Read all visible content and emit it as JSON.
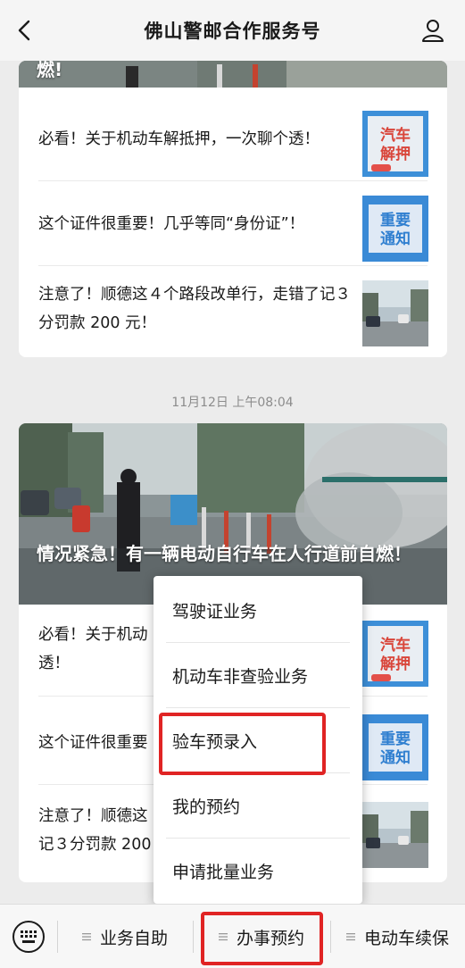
{
  "header": {
    "title": "佛山警邮合作服务号"
  },
  "card_top": {
    "hero_tail": "燃!",
    "rows": [
      {
        "text": "必看！关于机动车解抵押，一次聊个透！",
        "thumb_lines": [
          "汽车",
          "解押"
        ]
      },
      {
        "text": "这个证件很重要！几乎等同“身份证”！",
        "thumb_lines": [
          "重要",
          "通知"
        ]
      },
      {
        "text": "注意了！顺德这４个路段改单行，走错了记３分罚款 200 元！",
        "thumb_lines": []
      }
    ]
  },
  "timestamp": "11月12日 上午08:04",
  "card_main": {
    "hero_title": "情况紧急！有一辆电动自行车在人行道前自燃！",
    "rows": [
      {
        "text": "必看！关于机动车解抵押，一次聊个透！",
        "visible": "必看！关于机动",
        "line2": "透！",
        "thumb_lines": [
          "汽车",
          "解押"
        ]
      },
      {
        "text": "这个证件很重要！几乎等同“身份证”！",
        "visible": "这个证件很重要",
        "thumb_lines": [
          "重要",
          "通知"
        ]
      },
      {
        "text": "注意了！顺德这４个路段改单行，走错了记３分罚款 200 元！",
        "visible": "注意了！顺德这",
        "line2": "记３分罚款 200",
        "thumb_lines": []
      }
    ]
  },
  "menu": {
    "items": [
      "驾驶证业务",
      "机动车非查验业务",
      "验车预录入",
      "我的预约",
      "申请批量业务"
    ],
    "highlighted": "验车预录入"
  },
  "bottom_bar": {
    "tabs": [
      "业务自助",
      "办事预约",
      "电动车续保"
    ],
    "highlighted": "办事预约"
  },
  "colors": {
    "highlight_red": "#e02424",
    "thumb_red": "#d9453a",
    "thumb_blue": "#2f7fd0"
  }
}
